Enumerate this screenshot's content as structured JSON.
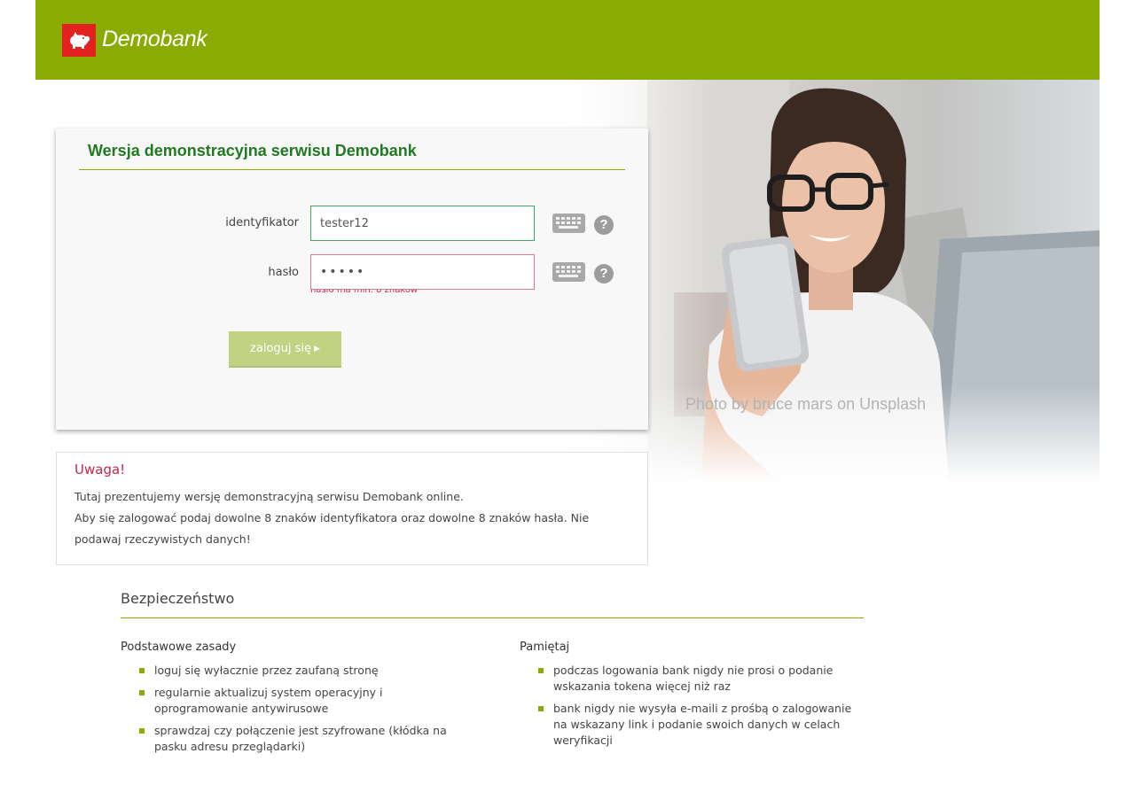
{
  "header": {
    "logo_text": "Demobank",
    "background_color": "#8aab04",
    "logo_color": "#e3211f",
    "logo_icon": "piggy-bank-icon"
  },
  "hero": {
    "photo_credit": "Photo by bruce mars on Unsplash"
  },
  "login": {
    "title": "Wersja demonstracyjna serwisu Demobank",
    "login_field": {
      "label": "identyfikator",
      "value": "tester12",
      "keyboard_icon": "keyboard-icon",
      "help_icon": "help-icon"
    },
    "password_field": {
      "label": "hasło",
      "value": "•••••",
      "error": "hasło ma min. 8 znaków",
      "keyboard_icon": "keyboard-icon",
      "help_icon": "help-icon"
    },
    "help_glyph": "?",
    "button_label": "zaloguj się",
    "button_arrow": "▶"
  },
  "warning": {
    "title": "Uwaga!",
    "line1": "Tutaj prezentujemy wersję demonstracyjną serwisu Demobank online.",
    "line2": "Aby się zalogować podaj dowolne 8 znaków identyfikatora oraz dowolne 8 znaków hasła. Nie podawaj rzeczywistych danych!"
  },
  "security": {
    "title": "Bezpieczeństwo",
    "columns": [
      {
        "heading": "Podstawowe zasady",
        "items": [
          "loguj się wyłacznie przez zaufaną stronę",
          "regularnie aktualizuj system operacyjny i oprogramowanie antywirusowe",
          "sprawdzaj czy połączenie jest szyfrowane (kłódka na pasku adresu przeglądarki)"
        ]
      },
      {
        "heading": "Pamiętaj",
        "items": [
          "podczas logowania bank nigdy nie prosi o podanie wskazania tokena więcej niż raz",
          "bank nigdy nie wysyła e-maili z prośbą o zalogowanie na wskazany link i podanie swoich danych w celach weryfikacji"
        ]
      }
    ]
  },
  "colors": {
    "accent": "#8aab04",
    "title_green": "#217a22",
    "error_red": "#c0284b",
    "button": "#c1d282"
  }
}
